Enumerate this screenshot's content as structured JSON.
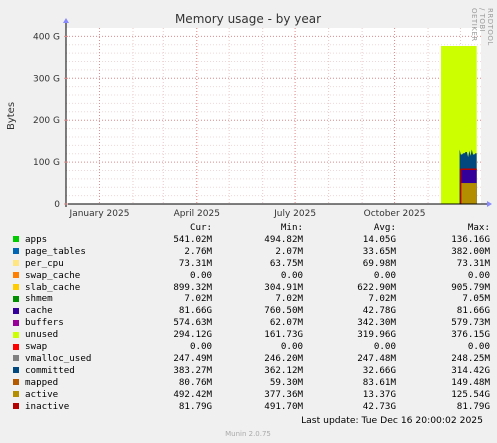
{
  "chart_data": {
    "type": "area",
    "title": "Memory usage - by year",
    "ylabel": "Bytes",
    "xlabel": "",
    "ylim": [
      0,
      420
    ],
    "y_unit": "G",
    "y_ticks": [
      {
        "value": 0,
        "label": "0"
      },
      {
        "value": 100,
        "label": "100 G"
      },
      {
        "value": 200,
        "label": "200 G"
      },
      {
        "value": 300,
        "label": "300 G"
      },
      {
        "value": 400,
        "label": "400 G"
      }
    ],
    "x_ticks": [
      {
        "date": "2025-01-01",
        "label": "January 2025"
      },
      {
        "date": "2025-04-01",
        "label": "April 2025"
      },
      {
        "date": "2025-07-01",
        "label": "July 2025"
      },
      {
        "date": "2025-10-01",
        "label": "October 2025"
      }
    ],
    "x_range": [
      "2024-12-01",
      "2025-12-20"
    ],
    "data_start": "2025-11-13",
    "data_end": "2025-12-16",
    "stacked_totals_G": {
      "unused_top": 377,
      "committed_level": 130,
      "mapped_level": 83,
      "active_level": 50
    },
    "columns": [
      "Cur:",
      "Min:",
      "Avg:",
      "Max:"
    ],
    "series": [
      {
        "name": "apps",
        "color": "#00cc00",
        "cur": "541.02M",
        "min": "494.82M",
        "avg": "14.05G",
        "max": "136.16G"
      },
      {
        "name": "page_tables",
        "color": "#0066b3",
        "cur": "2.76M",
        "min": "2.07M",
        "avg": "33.65M",
        "max": "382.00M"
      },
      {
        "name": "per_cpu",
        "color": "#ffe680",
        "cur": "73.31M",
        "min": "63.75M",
        "avg": "69.98M",
        "max": "73.31M"
      },
      {
        "name": "swap_cache",
        "color": "#ff8000",
        "cur": "0.00",
        "min": "0.00",
        "avg": "0.00",
        "max": "0.00"
      },
      {
        "name": "slab_cache",
        "color": "#ffcc00",
        "cur": "899.32M",
        "min": "304.91M",
        "avg": "622.90M",
        "max": "905.79M"
      },
      {
        "name": "shmem",
        "color": "#008f00",
        "cur": "7.02M",
        "min": "7.02M",
        "avg": "7.02M",
        "max": "7.05M"
      },
      {
        "name": "cache",
        "color": "#330099",
        "cur": "81.66G",
        "min": "760.50M",
        "avg": "42.78G",
        "max": "81.66G"
      },
      {
        "name": "buffers",
        "color": "#990099",
        "cur": "574.63M",
        "min": "62.07M",
        "avg": "342.30M",
        "max": "579.73M"
      },
      {
        "name": "unused",
        "color": "#ccff00",
        "cur": "294.12G",
        "min": "161.73G",
        "avg": "319.96G",
        "max": "376.15G"
      },
      {
        "name": "swap",
        "color": "#ff0000",
        "cur": "0.00",
        "min": "0.00",
        "avg": "0.00",
        "max": "0.00"
      },
      {
        "name": "vmalloc_used",
        "color": "#808080",
        "cur": "247.49M",
        "min": "246.20M",
        "avg": "247.48M",
        "max": "248.25M"
      },
      {
        "name": "committed",
        "color": "#00487d",
        "cur": "383.27M",
        "min": "362.12M",
        "avg": "32.66G",
        "max": "314.42G"
      },
      {
        "name": "mapped",
        "color": "#b35a00",
        "cur": "80.76M",
        "min": "59.30M",
        "avg": "83.61M",
        "max": "149.48M"
      },
      {
        "name": "active",
        "color": "#b38f00",
        "cur": "492.42M",
        "min": "377.36M",
        "avg": "13.37G",
        "max": "125.54G"
      },
      {
        "name": "inactive",
        "color": "#b30000",
        "cur": "81.79G",
        "min": "491.70M",
        "avg": "42.73G",
        "max": "81.79G"
      }
    ]
  },
  "footer": {
    "last_update": "Last update:  Tue Dec 16 20:00:02 2025",
    "version": "Munin 2.0.75"
  },
  "side_label": "RRDTOOL / TOBI OETIKER"
}
